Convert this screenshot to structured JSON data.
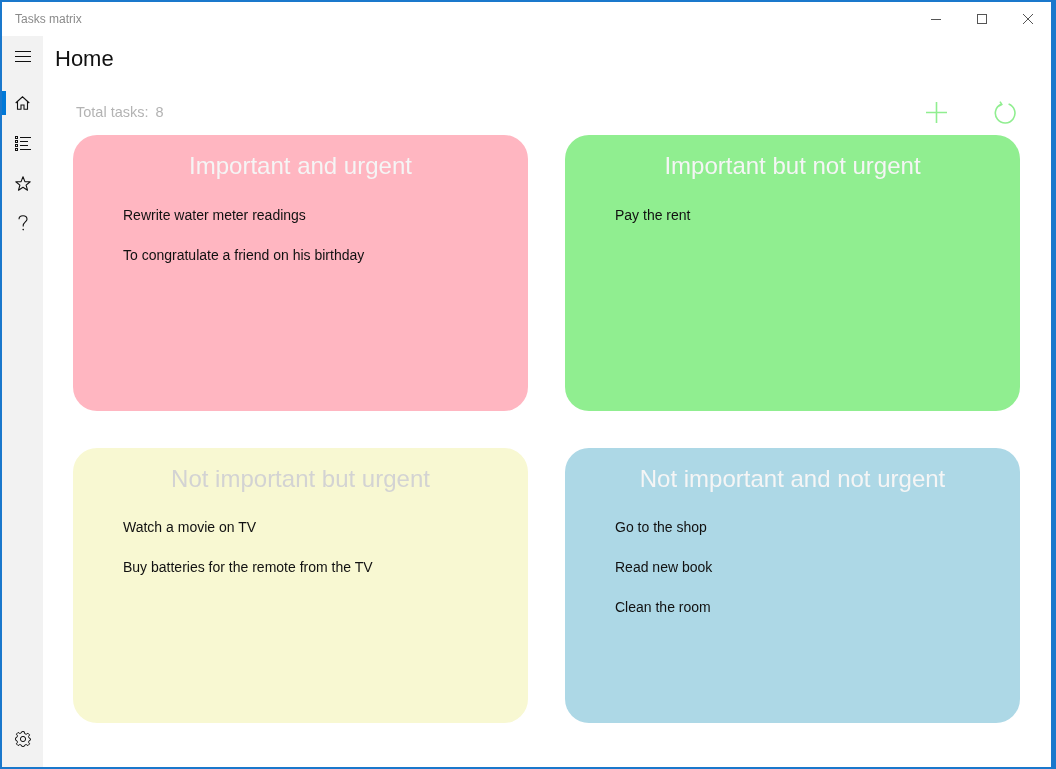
{
  "window": {
    "title": "Tasks matrix"
  },
  "nav_items": [
    {
      "kind": "home",
      "selected": true
    },
    {
      "kind": "list",
      "selected": false
    },
    {
      "kind": "star",
      "selected": false
    },
    {
      "kind": "help",
      "selected": false
    }
  ],
  "page": {
    "title": "Home",
    "total_label": "Total tasks:",
    "total_count": "8"
  },
  "quadrants": [
    {
      "title": "Important and urgent",
      "color": "#ffb6c1",
      "tasks": [
        "Rewrite water meter readings",
        "To congratulate a friend on his birthday"
      ]
    },
    {
      "title": "Important but not urgent",
      "color": "#90ee90",
      "tasks": [
        "Pay the rent"
      ]
    },
    {
      "title": "Not important but urgent",
      "color": "#f8f8d2",
      "tasks": [
        "Watch a movie on TV",
        "Buy batteries for the remote from the TV"
      ]
    },
    {
      "title": "Not important and not urgent",
      "color": "#add8e6",
      "tasks": [
        "Go to the shop",
        "Read new book",
        "Clean the room"
      ]
    }
  ]
}
